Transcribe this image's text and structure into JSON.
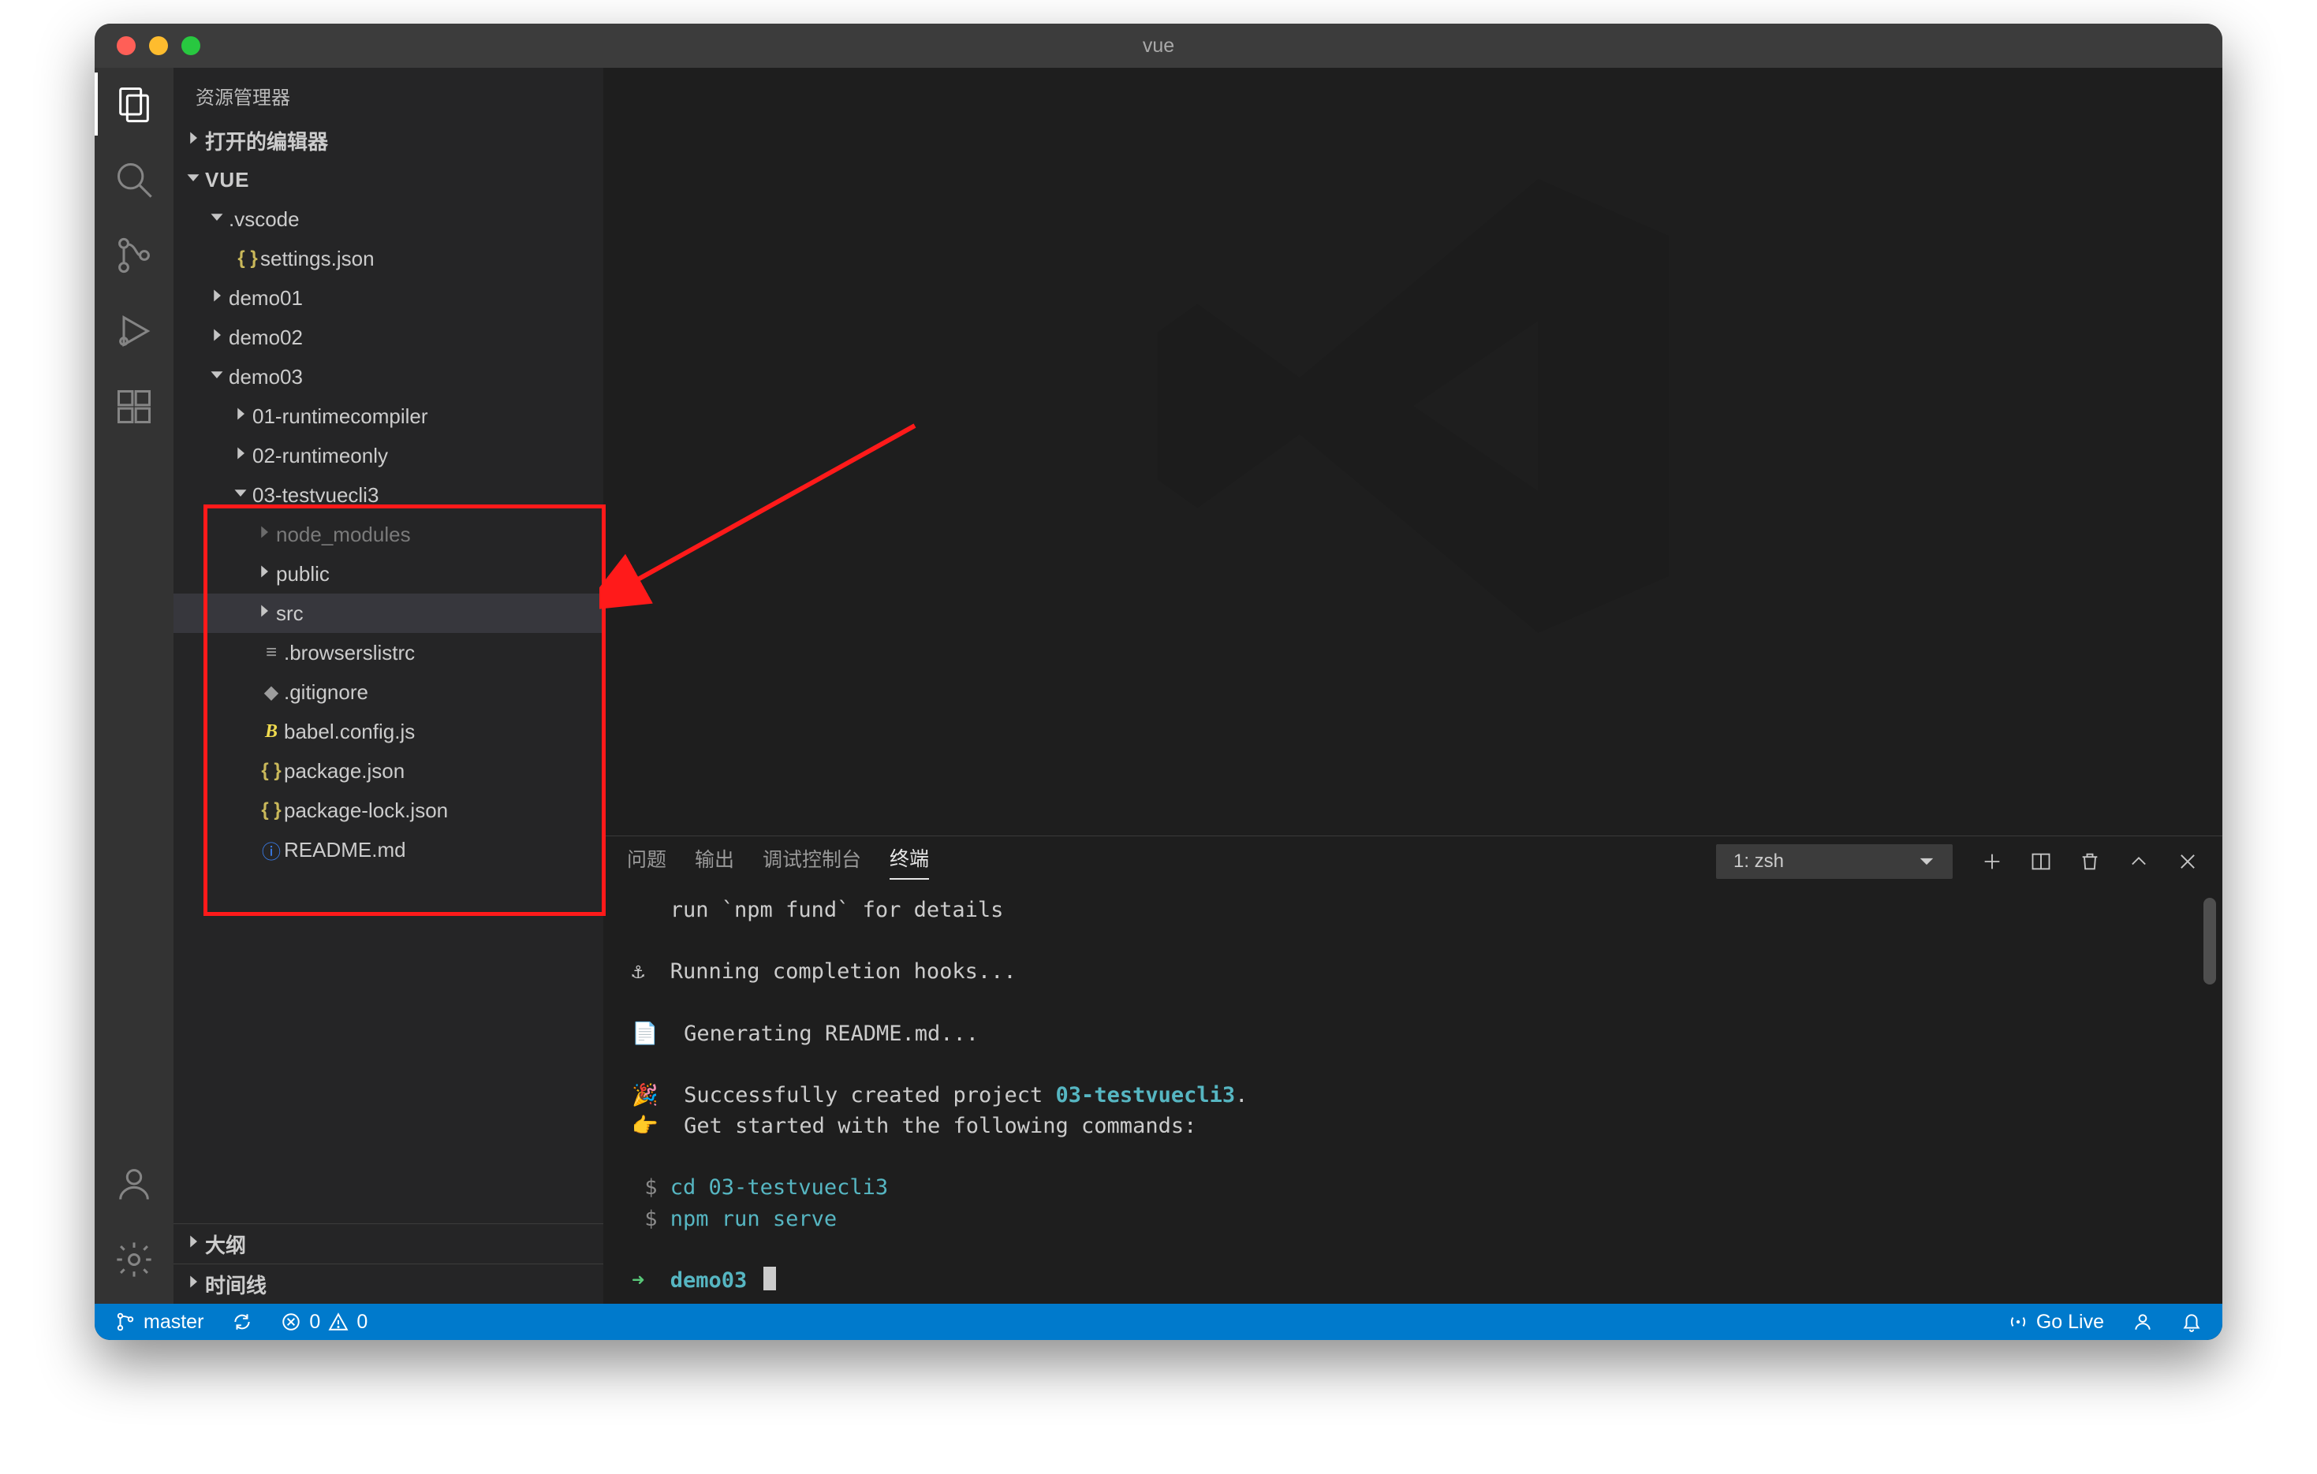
{
  "window": {
    "title": "vue"
  },
  "sidebar": {
    "title": "资源管理器",
    "sections": {
      "open_editors": "打开的编辑器",
      "workspace": "VUE",
      "outline": "大纲",
      "timeline": "时间线"
    },
    "tree": {
      "vscode": ".vscode",
      "settings": "settings.json",
      "demo01": "demo01",
      "demo02": "demo02",
      "demo03": "demo03",
      "runtimecompiler": "01-runtimecompiler",
      "runtimeonly": "02-runtimeonly",
      "testvuecli3": "03-testvuecli3",
      "node_modules": "node_modules",
      "public": "public",
      "src": "src",
      "browserslist": ".browserslistrc",
      "gitignore": ".gitignore",
      "babel": "babel.config.js",
      "package": "package.json",
      "package_lock": "package-lock.json",
      "readme": "README.md"
    }
  },
  "panel": {
    "tabs": {
      "problems": "问题",
      "output": "输出",
      "debug_console": "调试控制台",
      "terminal": "终端"
    },
    "shell_selector": "1: zsh"
  },
  "terminal": {
    "line_fund_prefix": "   run `npm fund` for details",
    "line_hooks": "⚓  Running completion hooks...",
    "line_readme": "📄  Generating README.md...",
    "line_success_emoji": "🎉  ",
    "line_success_a": "Successfully created project ",
    "line_success_b": "03-testvuecli3",
    "line_success_c": ".",
    "line_getstarted": "👉  Get started with the following commands:",
    "line_cmd1_prefix": " $ ",
    "line_cmd1": "cd 03-testvuecli3",
    "line_cmd2_prefix": " $ ",
    "line_cmd2": "npm run serve",
    "prompt_arrow": "➜  ",
    "prompt_dir": "demo03"
  },
  "statusbar": {
    "branch": "master",
    "errors": "0",
    "warnings": "0",
    "golive": "Go Live"
  }
}
